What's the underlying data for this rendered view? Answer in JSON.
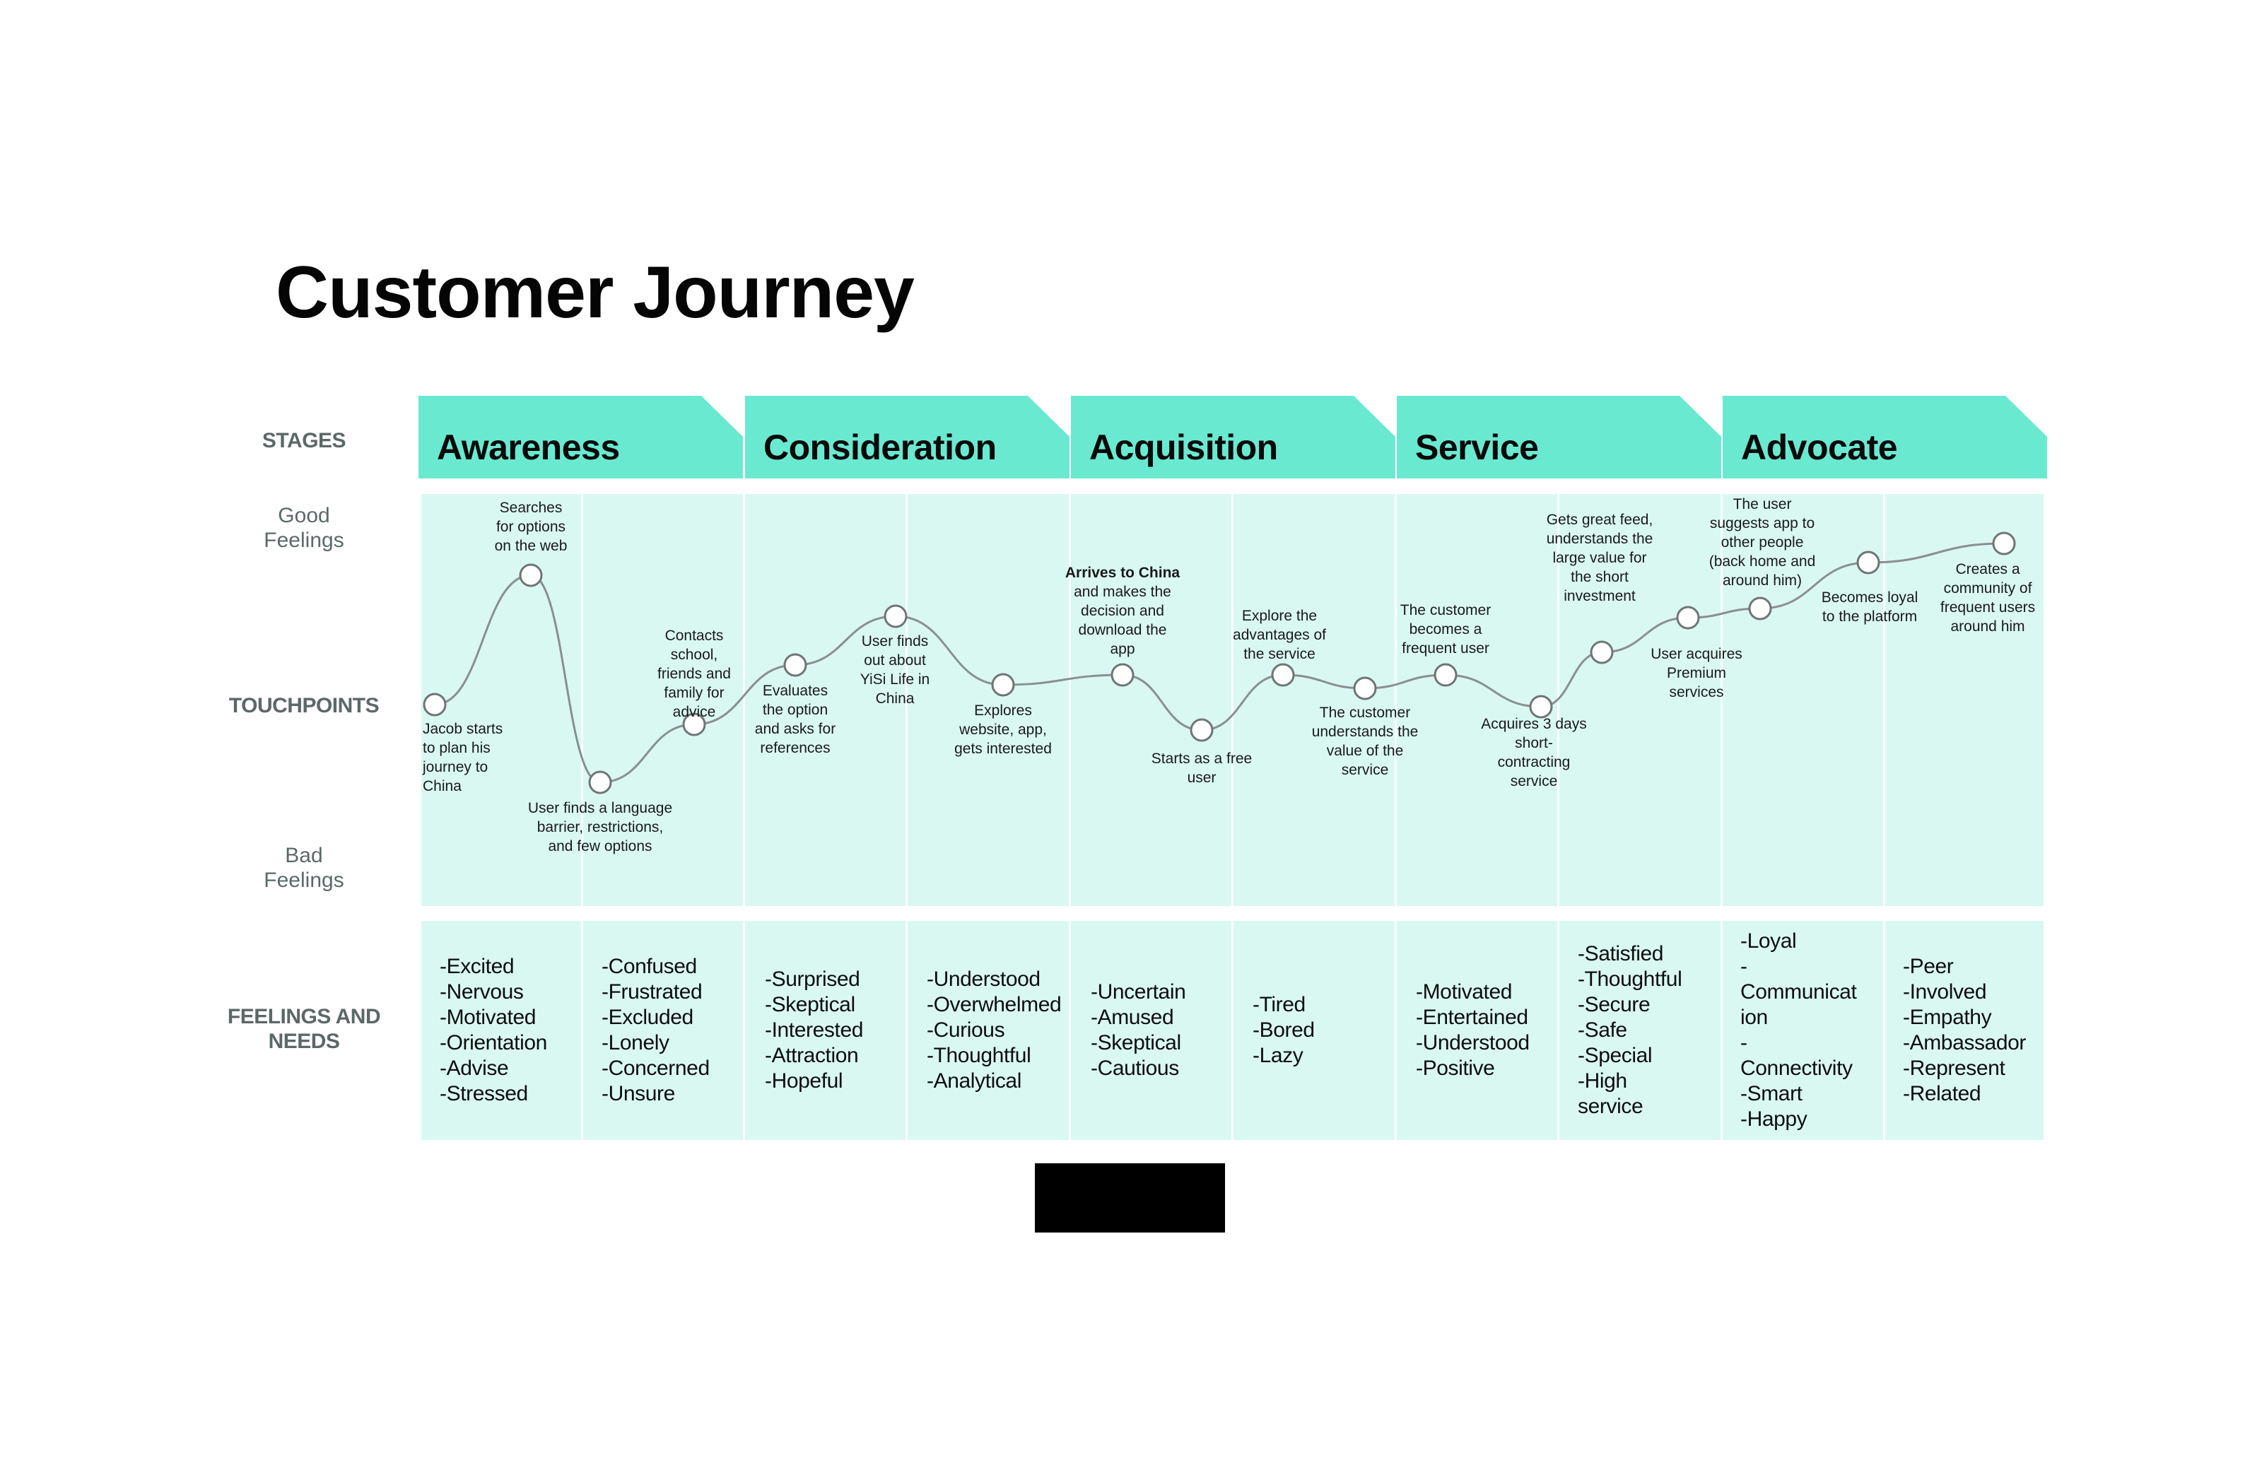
{
  "title": "Customer Journey",
  "row_labels": {
    "stages": "STAGES",
    "good_feelings": [
      "Good",
      "Feelings"
    ],
    "touchpoints": "TOUCHPOINTS",
    "bad_feelings": [
      "Bad",
      "Feelings"
    ],
    "feelings_and_needs": [
      "FEELINGS AND",
      "NEEDS"
    ]
  },
  "colors": {
    "stage_header": "#6ae9d1",
    "panel": "#d9f8f2",
    "row_label": "#5c6868",
    "curve": "#8a8f8f"
  },
  "stages": [
    {
      "name": "Awareness"
    },
    {
      "name": "Consideration"
    },
    {
      "name": "Acquisition"
    },
    {
      "name": "Service"
    },
    {
      "name": "Advocate"
    }
  ],
  "touchpoints": [
    {
      "label": [
        "Jacob starts",
        "to plan his",
        "journey to",
        "China"
      ],
      "feeling": "neutral",
      "stage": "Awareness"
    },
    {
      "label": [
        "Searches",
        "for options",
        "on the web"
      ],
      "feeling": "very good",
      "stage": "Awareness"
    },
    {
      "label": [
        "User finds a language",
        "barrier, restrictions,",
        "and few options"
      ],
      "feeling": "very bad",
      "stage": "Awareness"
    },
    {
      "label": [
        "Contacts",
        "school,",
        "friends and",
        "family for",
        "advice"
      ],
      "feeling": "slightly bad",
      "stage": "Awareness"
    },
    {
      "label": [
        "Evaluates",
        "the option",
        "and asks for",
        "references"
      ],
      "feeling": "slightly good",
      "stage": "Consideration"
    },
    {
      "label": [
        "User finds",
        "out about",
        "YiSi Life in",
        "China"
      ],
      "feeling": "good",
      "stage": "Consideration"
    },
    {
      "label": [
        "Explores",
        "website, app,",
        "gets interested"
      ],
      "feeling": "neutral",
      "stage": "Consideration"
    },
    {
      "label_bold": "Arrives to China",
      "label": [
        "and makes the",
        "decision and",
        "download the",
        "app"
      ],
      "feeling": "neutral",
      "stage": "Acquisition"
    },
    {
      "label": [
        "Starts as a free",
        "user"
      ],
      "feeling": "bad",
      "stage": "Acquisition"
    },
    {
      "label": [
        "Explore the",
        "advantages of",
        "the service"
      ],
      "feeling": "neutral",
      "stage": "Acquisition"
    },
    {
      "label": [
        "The customer",
        "understands the",
        "value of the",
        "service"
      ],
      "feeling": "neutral",
      "stage": "Acquisition"
    },
    {
      "label": [
        "The customer",
        "becomes a",
        "frequent user"
      ],
      "feeling": "neutral",
      "stage": "Service"
    },
    {
      "label": [
        "Acquires 3 days",
        "short-",
        "contracting",
        "service"
      ],
      "feeling": "slightly bad",
      "stage": "Service"
    },
    {
      "label": [
        "Gets great feed,",
        "understands the",
        "large value for",
        "the short",
        "investment"
      ],
      "feeling": "slightly good",
      "stage": "Service"
    },
    {
      "label": [
        "User acquires",
        "Premium",
        "services"
      ],
      "feeling": "good",
      "stage": "Service"
    },
    {
      "label": [
        "The user",
        "suggests app to",
        "other people",
        "(back home and",
        "around him)"
      ],
      "feeling": "good",
      "stage": "Advocate"
    },
    {
      "label": [
        "Becomes loyal",
        "to the platform"
      ],
      "feeling": "very good",
      "stage": "Advocate"
    },
    {
      "label": [
        "Creates a",
        "community of",
        "frequent users",
        "around him"
      ],
      "feeling": "very good",
      "stage": "Advocate"
    }
  ],
  "feelings": [
    [
      "-Excited",
      "-Nervous",
      "-Motivated",
      "-Orientation",
      "-Advise",
      "-Stressed"
    ],
    [
      "-Confused",
      "-Frustrated",
      "-Excluded",
      "-Lonely",
      "-Concerned",
      "-Unsure"
    ],
    [
      "-Surprised",
      "-Skeptical",
      "-Interested",
      "-Attraction",
      "-Hopeful"
    ],
    [
      "-Understood",
      "-Overwhelmed",
      "-Curious",
      "-Thoughtful",
      "-Analytical"
    ],
    [
      "-Uncertain",
      "-Amused",
      "-Skeptical",
      "-Cautious"
    ],
    [
      "-Tired",
      "-Bored",
      "-Lazy"
    ],
    [
      "-Motivated",
      "-Entertained",
      "-Understood",
      "-Positive"
    ],
    [
      "-Satisfied",
      "-Thoughtful",
      "-Secure",
      "-Safe",
      "-Special",
      "-High",
      "service"
    ],
    [
      "-Loyal",
      "-",
      "Communicat",
      "ion",
      "-",
      "Connectivity",
      "-Smart",
      "-Happy"
    ],
    [
      "-Peer",
      "-Involved",
      "-Empathy",
      "-Ambassador",
      "-Represent",
      "-Related"
    ]
  ]
}
